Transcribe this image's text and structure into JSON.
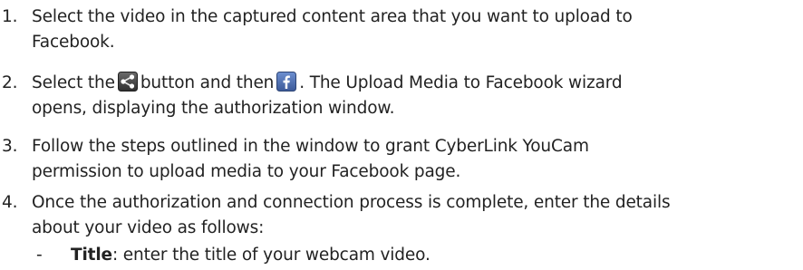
{
  "steps": [
    {
      "number": "1.",
      "line1": "Select the video in the captured content area that you want to upload to",
      "line2": "Facebook."
    },
    {
      "number": "2.",
      "before_share": "Select the",
      "between": "button and then",
      "after_fb": ". The Upload Media to Facebook wizard",
      "line2": "opens, displaying the authorization window.",
      "share_icon": "share-icon",
      "facebook_icon": "facebook-icon"
    },
    {
      "number": "3.",
      "line1": "Follow the steps outlined in the window to grant CyberLink YouCam",
      "line2": "permission to upload media to your Facebook page."
    },
    {
      "number": "4.",
      "line1": "Once the authorization and connection process is complete, enter the details",
      "line2": "about your video as follows:"
    }
  ],
  "subitem": {
    "dash": "-",
    "label": "Title",
    "text": ": enter the title of your webcam video."
  },
  "colors": {
    "text": "#222222",
    "facebook_blue": "#3b5998"
  }
}
